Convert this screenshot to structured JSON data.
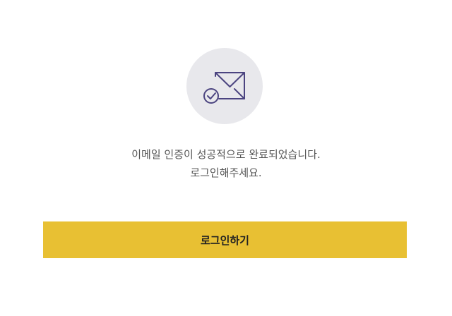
{
  "icon": {
    "name": "mail-check-icon",
    "circle_color": "#e8e8ec",
    "stroke_color": "#4b4480"
  },
  "message": {
    "line1": "이메일 인증이 성공적으로 완료되었습니다.",
    "line2": "로그인해주세요."
  },
  "login_button": {
    "label": "로그인하기",
    "color": "#e8c033"
  }
}
